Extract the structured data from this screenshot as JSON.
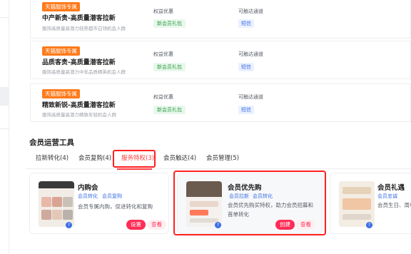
{
  "cards": [
    {
      "badge": "天猫服饰专属",
      "title": "中产新贵-高质量潜客拉新",
      "desc": "服饰高质量高潜力轻熟都市白领机会人群",
      "benefit_label": "权益优惠",
      "benefit_tag": "新会员礼包",
      "channel_label": "可触达通道",
      "channel_tag": "短信"
    },
    {
      "badge": "天猫服饰专属",
      "title": "品质客贵-高质量潜客拉新",
      "desc": "服饰高质量高潜力中年品质精英机会人群",
      "benefit_label": "权益优惠",
      "benefit_tag": "新会员礼包",
      "channel_label": "可触达通道",
      "channel_tag": "短信"
    },
    {
      "badge": "天猫服饰专属",
      "title": "精致新锐-高质量潜客拉新",
      "desc": "服饰高质量高潜力精致年轻机会人群",
      "benefit_label": "权益优惠",
      "benefit_tag": "新会员礼包",
      "channel_label": "可触达通道",
      "channel_tag": "短信"
    }
  ],
  "tools_section": {
    "title": "会员运营工具",
    "tabs": [
      "拉新转化(4)",
      "会员复购(4)",
      "服务特权(3)",
      "会员触达(4)",
      "会员管理(5)"
    ],
    "active_tab_index": 2
  },
  "tools": [
    {
      "name": "内购会",
      "tags": [
        "会员转化",
        "会员复购"
      ],
      "desc": "会员专属内购，促进转化和复购",
      "primary": "设置",
      "secondary": "查看"
    },
    {
      "name": "会员优先购",
      "tags": [
        "会员拉新",
        "会员转化"
      ],
      "desc": "会员优先购买特权，助力会员招募和首单转化",
      "primary": "创建",
      "secondary": "查看"
    },
    {
      "name": "会员礼遇",
      "tags": [
        "会员忠诚"
      ],
      "desc": "会员生日、周年日等专属礼遇，提升进店转化",
      "primary": "",
      "secondary": ""
    }
  ],
  "colors": {
    "accent": "#ff2d55",
    "badge": "#ff7a1a",
    "highlight": "#ff2020",
    "link": "#3d6fe6"
  }
}
